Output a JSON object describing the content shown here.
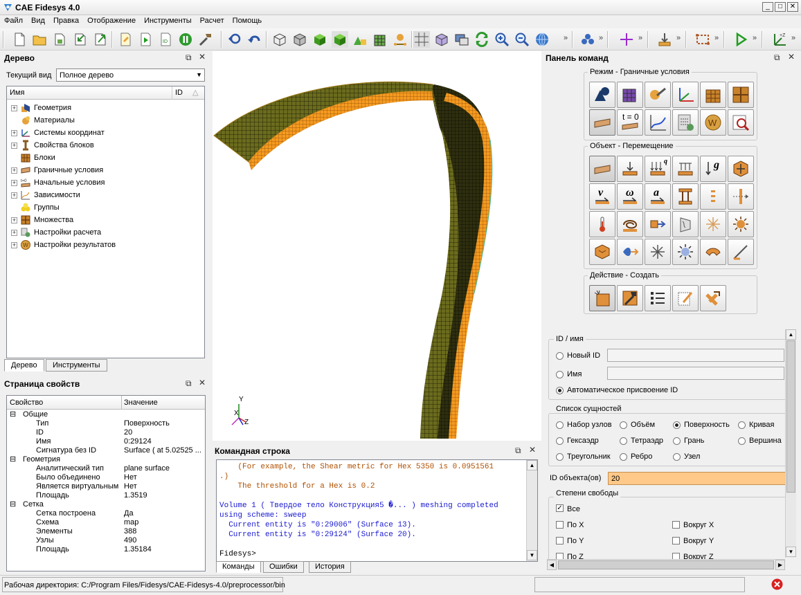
{
  "window": {
    "title": "CAE Fidesys 4.0",
    "controls": [
      "minimize-icon",
      "maximize-icon",
      "close-icon"
    ]
  },
  "menu": [
    "Файл",
    "Вид",
    "Правка",
    "Отображение",
    "Инструменты",
    "Расчет",
    "Помощь"
  ],
  "toolbar": {
    "icons": [
      "new-file-icon",
      "open-folder-icon",
      "save-icon",
      "import-icon",
      "export-icon",
      "script-icon",
      "play-script-icon",
      "id-script-icon",
      "pause-icon",
      "tools-icon",
      "undo-back-icon",
      "undo-icon",
      "wireframe-icon",
      "hidden-line-icon",
      "shaded-icon",
      "smooth-shade-icon",
      "shape-icon",
      "mesh-icon",
      "nodes-icon",
      "grid-icon",
      "transparent-icon",
      "display-icon",
      "refresh-icon",
      "zoom-in-icon",
      "zoom-out-icon",
      "globe-icon",
      "cluster-icon",
      "crosshair-icon",
      "load-icon",
      "bbox-icon",
      "run-icon",
      "axes-icon"
    ],
    "overflow": "»"
  },
  "tree_panel": {
    "title": "Дерево",
    "current_view_label": "Текущий вид",
    "current_view_value": "Полное дерево",
    "col_name": "Имя",
    "col_id": "ID",
    "items": [
      {
        "label": "Геометрия",
        "expandable": true,
        "icon": "geometry-icon"
      },
      {
        "label": "Материалы",
        "expandable": false,
        "icon": "materials-icon"
      },
      {
        "label": "Системы координат",
        "expandable": true,
        "icon": "coordinate-system-icon"
      },
      {
        "label": "Свойства блоков",
        "expandable": true,
        "icon": "block-properties-icon"
      },
      {
        "label": "Блоки",
        "expandable": false,
        "icon": "blocks-icon"
      },
      {
        "label": "Граничные условия",
        "expandable": true,
        "icon": "boundary-conditions-icon"
      },
      {
        "label": "Начальные условия",
        "expandable": true,
        "icon": "initial-conditions-icon"
      },
      {
        "label": "Зависимости",
        "expandable": true,
        "icon": "dependencies-icon"
      },
      {
        "label": "Группы",
        "expandable": false,
        "icon": "groups-icon"
      },
      {
        "label": "Множества",
        "expandable": true,
        "icon": "sets-icon"
      },
      {
        "label": "Настройки расчета",
        "expandable": true,
        "icon": "calc-settings-icon"
      },
      {
        "label": "Настройки результатов",
        "expandable": true,
        "icon": "results-settings-icon"
      }
    ],
    "tabs": [
      "Дерево",
      "Инструменты"
    ]
  },
  "properties_panel": {
    "title": "Страница свойств",
    "col_property": "Свойство",
    "col_value": "Значение",
    "rows": [
      {
        "indent": 0,
        "expander": "⊟",
        "name": "Общие",
        "value": ""
      },
      {
        "indent": 1,
        "expander": "",
        "name": "Тип",
        "value": "Поверхность"
      },
      {
        "indent": 1,
        "expander": "",
        "name": "ID",
        "value": "20"
      },
      {
        "indent": 1,
        "expander": "",
        "name": "Имя",
        "value": "0:29124"
      },
      {
        "indent": 1,
        "expander": "",
        "name": "Сигнатура без ID",
        "value": "Surface ( at 5.02525 ..."
      },
      {
        "indent": 0,
        "expander": "⊟",
        "name": "Геометрия",
        "value": ""
      },
      {
        "indent": 1,
        "expander": "",
        "name": "Аналитический тип",
        "value": "plane surface"
      },
      {
        "indent": 1,
        "expander": "",
        "name": "Было объединено",
        "value": "Нет"
      },
      {
        "indent": 1,
        "expander": "",
        "name": "Является виртуальным",
        "value": "Нет"
      },
      {
        "indent": 1,
        "expander": "",
        "name": "Площадь",
        "value": "1.3519"
      },
      {
        "indent": 0,
        "expander": "⊟",
        "name": "Сетка",
        "value": ""
      },
      {
        "indent": 1,
        "expander": "",
        "name": "Сетка построена",
        "value": "Да"
      },
      {
        "indent": 1,
        "expander": "",
        "name": "Схема",
        "value": "map"
      },
      {
        "indent": 1,
        "expander": "",
        "name": "Элементы",
        "value": "388"
      },
      {
        "indent": 1,
        "expander": "",
        "name": "Узлы",
        "value": "490"
      },
      {
        "indent": 1,
        "expander": "",
        "name": "Площадь",
        "value": "1.35184"
      }
    ]
  },
  "viewport": {
    "axis_labels": {
      "x": "X",
      "y": "Y",
      "z": "Z"
    }
  },
  "command_line": {
    "title": "Командная строка",
    "lines": [
      {
        "text": "    (For example, the Shear metric for Hex 5350 is 0.0951561",
        "color": "#b05000"
      },
      {
        "text": ".)",
        "color": "#b05000"
      },
      {
        "text": "    The threshold for a Hex is 0.2",
        "color": "#b05000"
      },
      {
        "text": "",
        "color": "#000"
      },
      {
        "text": "Volume 1 ( Твердое тело Конструкция5 �... ) meshing completed",
        "color": "#1a1ad0"
      },
      {
        "text": "using scheme: sweep",
        "color": "#1a1ad0"
      },
      {
        "text": "  Current entity is \"0:29006\" (Surface 13).",
        "color": "#1a1ad0"
      },
      {
        "text": "  Current entity is \"0:29124\" (Surface 20).",
        "color": "#1a1ad0"
      },
      {
        "text": "",
        "color": "#000"
      },
      {
        "text": "Fidesys>",
        "color": "#000"
      }
    ],
    "tabs": [
      "Команды",
      "Ошибки",
      "История"
    ]
  },
  "command_panel": {
    "title": "Панель команд",
    "mode_group": "Режим - Граничные условия",
    "object_group": "Объект - Перемещение",
    "action_group": "Действие - Создать",
    "mode_icons": [
      "geometry-mode-icon",
      "mesh-mode-icon",
      "tools-mode-icon",
      "coord-system-mode-icon",
      "blocks-mode-icon",
      "sets-mode-icon",
      "boundary-conditions-mode-icon",
      "initial-conditions-mode-icon",
      "dependencies-mode-icon",
      "calc-mode-icon",
      "results-mode-icon",
      "analysis-mode-icon"
    ],
    "t0_label": "t = 0",
    "object_icons": [
      "displacement-icon",
      "force-icon",
      "distributed-load-icon",
      "pressure-icon",
      "gravity-icon",
      "constraint-icon",
      "velocity-icon",
      "angular-velocity-icon",
      "acceleration-icon",
      "beam-icon",
      "contact-icon",
      "slide-icon",
      "temperature-icon",
      "convection-icon",
      "heat-flux-icon",
      "radiation-icon",
      "point-source-icon",
      "heat-source-icon",
      "box-load-icon",
      "flow-icon",
      "star-icon",
      "sun-icon",
      "shell-icon",
      "angle-icon"
    ],
    "action_icons": [
      "create-icon",
      "modify-icon",
      "list-icon",
      "edit-icon",
      "delete-icon"
    ],
    "object_glyphs": {
      "velocity": "v",
      "angular": "ω",
      "accel": "a",
      "gravity": "g",
      "q": "q"
    },
    "id_group": "ID / имя",
    "new_id_label": "Новый ID",
    "name_label": "Имя",
    "auto_id_label": "Автоматическое присвоение ID",
    "entity_group": "Список сущностей",
    "entities": [
      {
        "label": "Набор узлов",
        "selected": false
      },
      {
        "label": "Объём",
        "selected": false
      },
      {
        "label": "Поверхность",
        "selected": true
      },
      {
        "label": "Кривая",
        "selected": false
      },
      {
        "label": "Гексаэдр",
        "selected": false
      },
      {
        "label": "Тетраэдр",
        "selected": false
      },
      {
        "label": "Грань",
        "selected": false
      },
      {
        "label": "Вершина",
        "selected": false
      },
      {
        "label": "Треугольник",
        "selected": false
      },
      {
        "label": "Ребро",
        "selected": false
      },
      {
        "label": "Узел",
        "selected": false
      }
    ],
    "object_id_label": "ID объекта(ов)",
    "object_id_value": "20",
    "dof_group": "Степени свободы",
    "all_label": "Все",
    "all_checked": true,
    "dofs": [
      "По X",
      "Вокруг X",
      "По Y",
      "Вокруг Y",
      "По Z",
      "Вокруг Z"
    ]
  },
  "status": {
    "working_dir": "Рабочая директория: C:/Program Files/Fidesys/CAE-Fidesys-4.0/preprocessor/bin"
  },
  "colors": {
    "mesh_orange": "#f59a20",
    "mesh_dark": "#3a3a12",
    "mesh_olive": "#6b6b1e",
    "object_id_bg": "#ffc98a",
    "cmd_blue": "#1a1ad0",
    "cmd_orange": "#b05000"
  }
}
